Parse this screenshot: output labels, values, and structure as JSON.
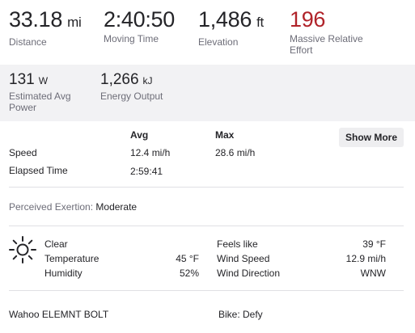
{
  "stats": {
    "distance": {
      "value": "33.18",
      "unit": "mi",
      "label": "Distance"
    },
    "moving_time": {
      "value": "2:40:50",
      "label": "Moving Time"
    },
    "elevation": {
      "value": "1,486",
      "unit": "ft",
      "label": "Elevation"
    },
    "relative_effort": {
      "value": "196",
      "label_line1": "Massive Relative",
      "label_line2": "Effort",
      "color": "#b0232a"
    }
  },
  "power": {
    "avg_power": {
      "value": "131",
      "unit": "W",
      "label_line1": "Estimated Avg",
      "label_line2": "Power"
    },
    "energy": {
      "value": "1,266",
      "unit": "kJ",
      "label": "Energy Output"
    }
  },
  "detail_table": {
    "col_avg": "Avg",
    "col_max": "Max",
    "show_more": "Show More",
    "rows": [
      {
        "label": "Speed",
        "avg": "12.4 mi/h",
        "max": "28.6 mi/h"
      },
      {
        "label": "Elapsed Time",
        "avg": "2:59:41",
        "max": ""
      }
    ]
  },
  "exertion": {
    "label": "Perceived Exertion:",
    "value": "Moderate"
  },
  "weather": {
    "icon": "sun-icon",
    "condition": "Clear",
    "temperature_label": "Temperature",
    "temperature_value": "45 °F",
    "humidity_label": "Humidity",
    "humidity_value": "52%",
    "feels_like_label": "Feels like",
    "feels_like_value": "39 °F",
    "wind_speed_label": "Wind Speed",
    "wind_speed_value": "12.9 mi/h",
    "wind_direction_label": "Wind Direction",
    "wind_direction_value": "WNW"
  },
  "gear": {
    "device": "Wahoo ELEMNT BOLT",
    "bike": "Bike: Defy"
  }
}
